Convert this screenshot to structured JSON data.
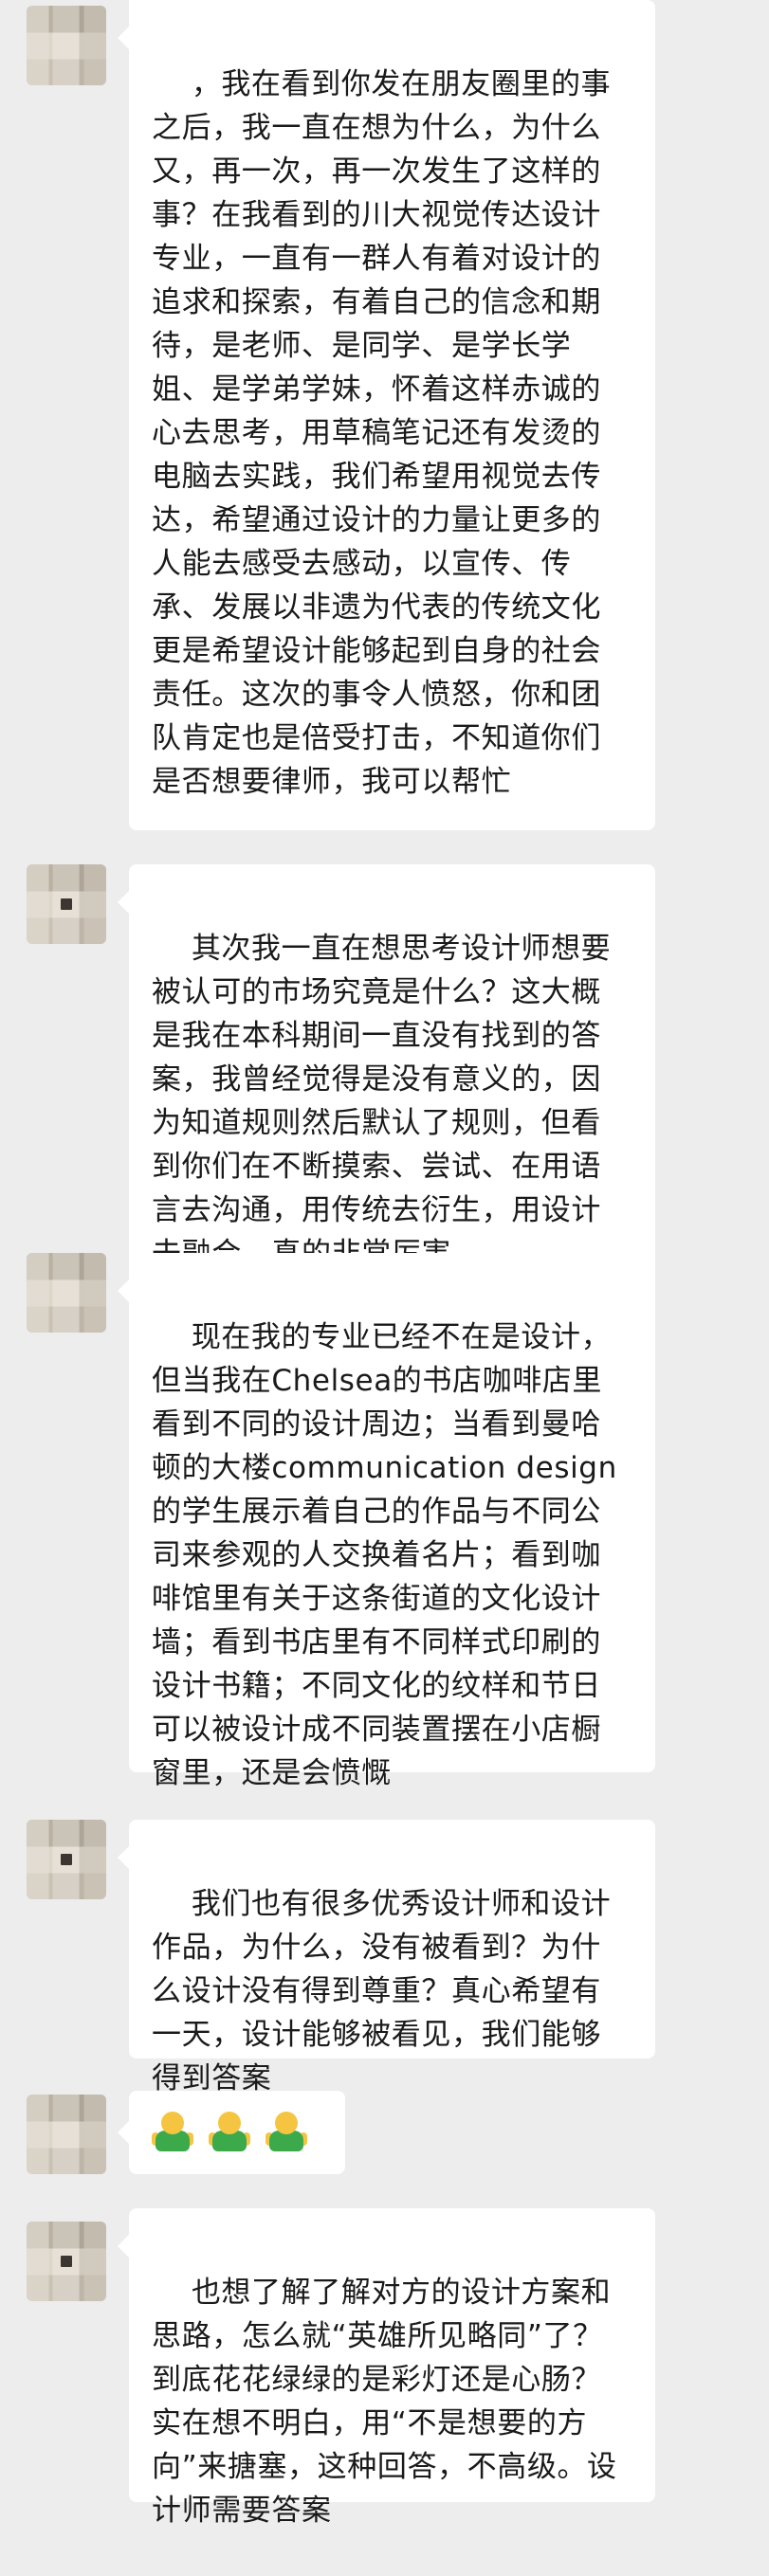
{
  "messages": [
    {
      "id": 1,
      "text": "，我在看到你发在朋友圈里的事之后，我一直在想为什么，为什么又，再一次，再一次发生了这样的事？在我看到的川大视觉传达设计专业，一直有一群人有着对设计的追求和探索，有着自己的信念和期待，是老师、是同学、是学长学姐、是学弟学妹，怀着这样赤诚的心去思考，用草稿笔记还有发烫的电脑去实践，我们希望用视觉去传达，希望通过设计的力量让更多的人能去感受去感动，以宣传、传承、发展以非遗为代表的传统文化更是希望设计能够起到自身的社会责任。这次的事令人愤怒，你和团队肯定也是倍受打击，不知道你们是否想要律师，我可以帮忙"
    },
    {
      "id": 2,
      "text": "其次我一直在想思考设计师想要被认可的市场究竟是什么？这大概是我在本科期间一直没有找到的答案，我曾经觉得是没有意义的，因为知道规则然后默认了规则，但看到你们在不断摸索、尝试、在用语言去沟通，用传统去衍生，用设计去融合，真的非常厉害。"
    },
    {
      "id": 3,
      "text": "现在我的专业已经不在是设计，但当我在Chelsea的书店咖啡店里看到不同的设计周边；当看到曼哈顿的大楼communication design的学生展示着自己的作品与不同公司来参观的人交换着名片；看到咖啡馆里有关于这条街道的文化设计墙；看到书店里有不同样式印刷的设计书籍；不同文化的纹样和节日可以被设计成不同装置摆在小店橱窗里，还是会愤慨"
    },
    {
      "id": 4,
      "text": "我们也有很多优秀设计师和设计作品，为什么，没有被看到？为什么设计没有得到尊重？真心希望有一天，设计能够被看见，我们能够得到答案"
    },
    {
      "id": 5,
      "emoji": [
        "cheer-emoji",
        "cheer-emoji",
        "cheer-emoji"
      ]
    },
    {
      "id": 6,
      "text": "也想了解了解对方的设计方案和思路，怎么就“英雄所见略同”了？到底花花绿绿的是彩灯还是心肠？实在想不明白，用“不是想要的方向”来搪塞，这种回答，不高级。设计师需要答案"
    }
  ],
  "colors": {
    "background": "#ededed",
    "bubble": "#ffffff",
    "text": "#1a1a1a"
  }
}
